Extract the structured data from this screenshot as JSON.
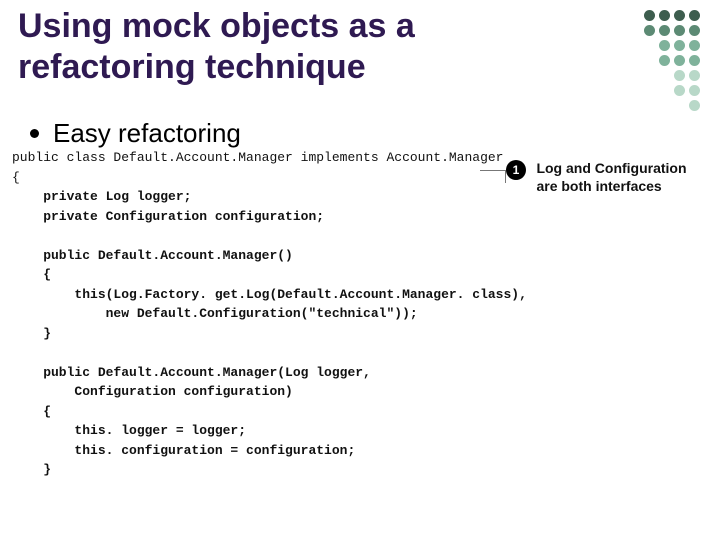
{
  "title_line1": "Using mock objects as a",
  "title_line2": "refactoring technique",
  "bullet": "Easy refactoring",
  "code": {
    "l1": "public class Default.Account.Manager implements Account.Manager",
    "l2": "{",
    "l3": "    private Log logger;",
    "l4": "    private Configuration configuration;",
    "l5": "",
    "l6": "    public Default.Account.Manager()",
    "l7": "    {",
    "l8": "        this(Log.Factory. get.Log(Default.Account.Manager. class),",
    "l9": "            new Default.Configuration(\"technical\"));",
    "l10": "    }",
    "l11": "",
    "l12": "    public Default.Account.Manager(Log logger,",
    "l13": "        Configuration configuration)",
    "l14": "    {",
    "l15": "        this. logger = logger;",
    "l16": "        this. configuration = configuration;",
    "l17": "    }"
  },
  "callout": {
    "num": "1",
    "text": "Log and Configuration are both interfaces"
  },
  "decor_colors": [
    "g1",
    "g2",
    "g3",
    "g4"
  ]
}
